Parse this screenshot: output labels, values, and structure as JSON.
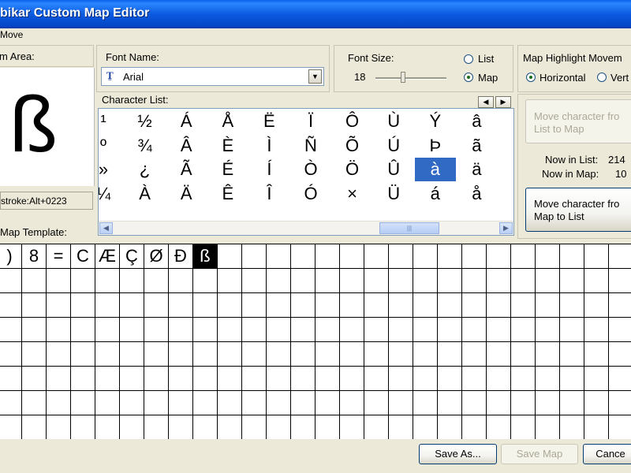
{
  "window": {
    "title": "bikar Custom Map Editor"
  },
  "menu": {
    "items": [
      "Move"
    ]
  },
  "preview": {
    "title": "m Area:",
    "char": "ß",
    "keystroke": "stroke:Alt+0223"
  },
  "font_name": {
    "title": "Font Name:",
    "value": "Arial",
    "icon": "truetype-font-icon"
  },
  "font_size": {
    "title": "Font Size:",
    "value": "18",
    "list_label": "List",
    "map_label": "Map",
    "selected": "Map"
  },
  "highlight": {
    "title": "Map Highlight Movem",
    "horizontal_label": "Horizontal",
    "vertical_label": "Vert",
    "selected": "Horizontal"
  },
  "char_list": {
    "title": "Character List:",
    "rows": [
      [
        "¹",
        "½",
        "Á",
        "Å",
        "Ë",
        "Ï",
        "Ô",
        "Ù",
        "Ý",
        "â"
      ],
      [
        "º",
        "¾",
        "Â",
        "È",
        "Ì",
        "Ñ",
        "Õ",
        "Ú",
        "Þ",
        "ã"
      ],
      [
        "»",
        "¿",
        "Ã",
        "É",
        "Í",
        "Ò",
        "Ö",
        "Û",
        "à",
        "ä"
      ],
      [
        "¼",
        "À",
        "Ä",
        "Ê",
        "Î",
        "Ó",
        "×",
        "Ü",
        "á",
        "å"
      ]
    ],
    "selected": [
      2,
      8
    ]
  },
  "actions": {
    "to_map": "Move character fro\nList to Map",
    "to_list": "Move character fro\nMap to List",
    "now_in_list_label": "Now in List:",
    "now_in_list": "214",
    "now_in_map_label": "Now in Map:",
    "now_in_map": "10"
  },
  "map_template": {
    "title": "Map Template:",
    "cells": [
      ")",
      "8",
      "=",
      "C",
      "Æ",
      "Ç",
      "Ø",
      "Ð",
      "ß"
    ],
    "selected_index": 8
  },
  "buttons": {
    "save_as": "Save As...",
    "save_map": "Save Map",
    "cancel": "Cance"
  }
}
